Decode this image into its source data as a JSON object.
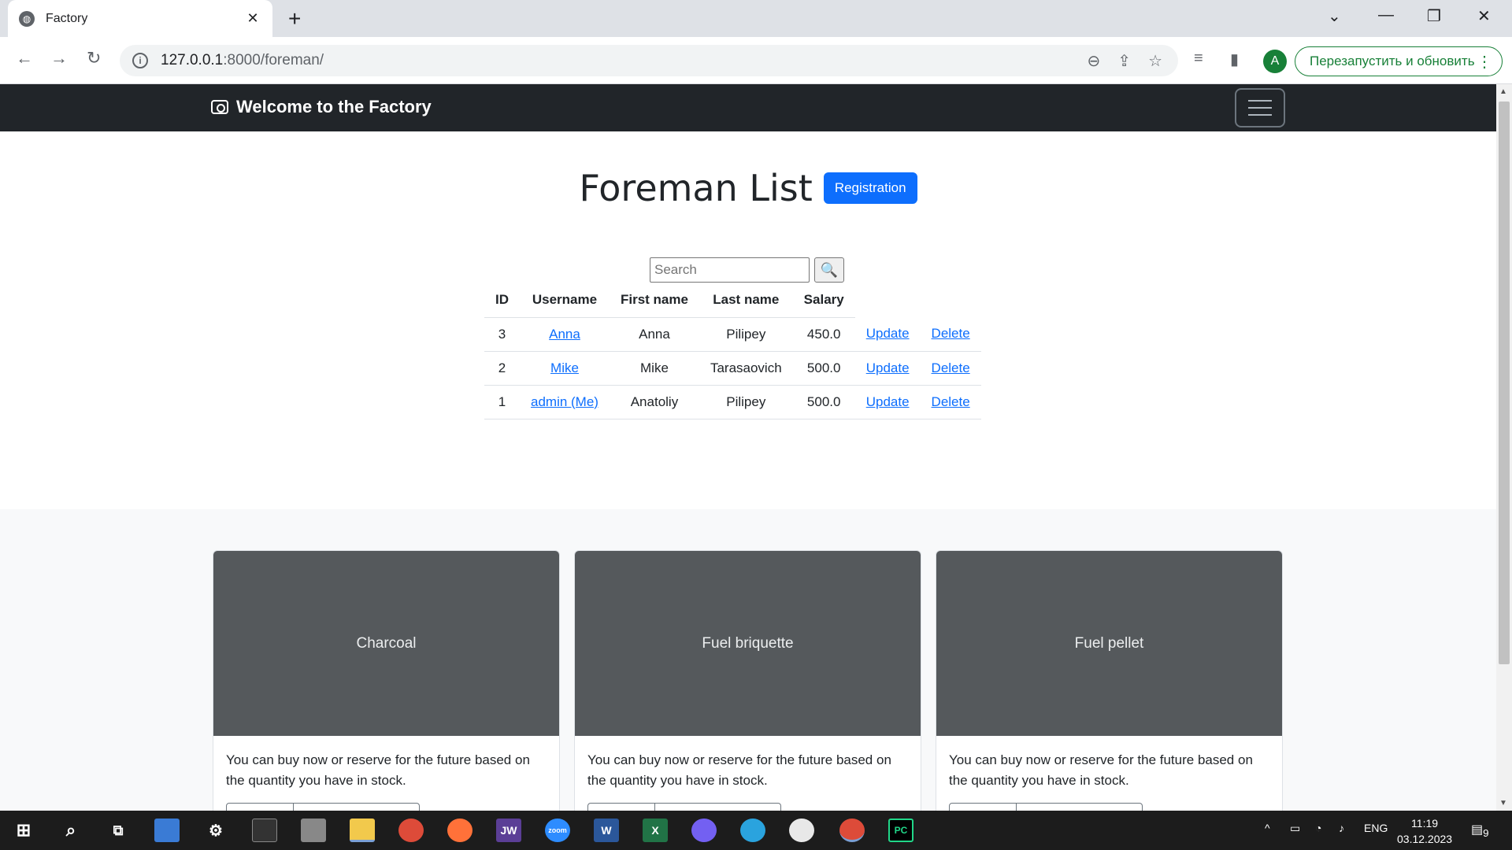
{
  "browser": {
    "tab_title": "Factory",
    "url_host": "127.0.0.1",
    "url_rest": ":8000/foreman/",
    "relaunch_label": "Перезапустить и обновить",
    "profile_initial": "A"
  },
  "navbar": {
    "brand": "Welcome to the Factory"
  },
  "main": {
    "title": "Foreman List",
    "registration_label": "Registration",
    "search_placeholder": "Search",
    "table": {
      "headers": [
        "ID",
        "Username",
        "First name",
        "Last name",
        "Salary"
      ],
      "rows": [
        {
          "id": "3",
          "username": "Anna",
          "first_name": "Anna",
          "last_name": "Pilipey",
          "salary": "450.0",
          "update": "Update",
          "delete": "Delete"
        },
        {
          "id": "2",
          "username": "Mike",
          "first_name": "Mike",
          "last_name": "Tarasaovich",
          "salary": "500.0",
          "update": "Update",
          "delete": "Delete"
        },
        {
          "id": "1",
          "username": "admin (Me)",
          "first_name": "Anatoliy",
          "last_name": "Pilipey",
          "salary": "500.0",
          "update": "Update",
          "delete": "Delete"
        }
      ]
    }
  },
  "cards": [
    {
      "title": "Charcoal",
      "text": "You can buy now or reserve for the future based on the quantity you have in stock."
    },
    {
      "title": "Fuel briquette",
      "text": "You can buy now or reserve for the future based on the quantity you have in stock."
    },
    {
      "title": "Fuel pellet",
      "text": "You can buy now or reserve for the future based on the quantity you have in stock."
    }
  ],
  "taskbar": {
    "lang": "ENG",
    "time": "11:19",
    "date": "03.12.2023",
    "notifications": "9"
  },
  "colors": {
    "navbar_bg": "#212529",
    "primary": "#0d6efd",
    "card_image_bg": "#55595c",
    "relaunch_green": "#188038"
  }
}
